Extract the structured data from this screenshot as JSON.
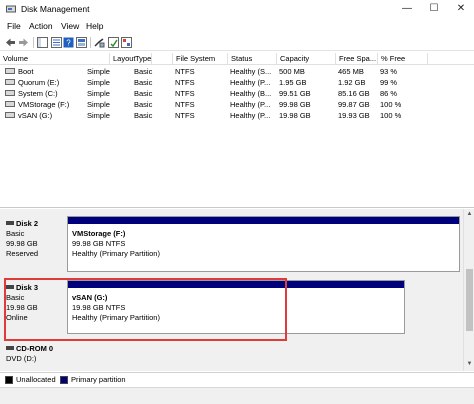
{
  "window": {
    "title": "Disk Management"
  },
  "menu": [
    "File",
    "Action",
    "View",
    "Help"
  ],
  "toolbar": [
    "back-arrow-icon",
    "forward-arrow-icon",
    "properties-icon",
    "help-icon",
    "connect-icon",
    "refresh-icon",
    "check-icon"
  ],
  "volume_list": {
    "columns": [
      "Volume",
      "Layout",
      "Type",
      "File System",
      "Status",
      "Capacity",
      "Free Spa...",
      "% Free"
    ],
    "rows": [
      [
        "Boot",
        "Simple",
        "Basic",
        "NTFS",
        "Healthy (S...",
        "500 MB",
        "465 MB",
        "93 %"
      ],
      [
        "Quorum (E:)",
        "Simple",
        "Basic",
        "NTFS",
        "Healthy (P...",
        "1.95 GB",
        "1.92 GB",
        "99 %"
      ],
      [
        "System (C:)",
        "Simple",
        "Basic",
        "NTFS",
        "Healthy (B...",
        "99.51 GB",
        "85.16 GB",
        "86 %"
      ],
      [
        "VMStorage (F:)",
        "Simple",
        "Basic",
        "NTFS",
        "Healthy (P...",
        "99.98 GB",
        "99.87 GB",
        "100 %"
      ],
      [
        "vSAN (G:)",
        "Simple",
        "Basic",
        "NTFS",
        "Healthy (P...",
        "19.98 GB",
        "19.93 GB",
        "100 %"
      ]
    ]
  },
  "disks": [
    {
      "name": "Disk 2",
      "type": "Basic",
      "size": "99.98 GB",
      "state": "Reserved",
      "partition": {
        "name": "VMStorage  (F:)",
        "size_fs": "99.98 GB NTFS",
        "status": "Healthy (Primary Partition)"
      }
    },
    {
      "name": "Disk 3",
      "type": "Basic",
      "size": "19.98 GB",
      "state": "Online",
      "partition": {
        "name": "vSAN  (G:)",
        "size_fs": "19.98 GB NTFS",
        "status": "Healthy (Primary Partition)"
      }
    },
    {
      "name": "CD-ROM 0",
      "type": "DVD (D:)"
    }
  ],
  "legend": [
    {
      "label": "Unallocated",
      "color": "#000000"
    },
    {
      "label": "Primary partition",
      "color": "#00007c"
    }
  ],
  "colors": {
    "partition_bar": "#00007c",
    "highlight": "#e03a3a"
  }
}
